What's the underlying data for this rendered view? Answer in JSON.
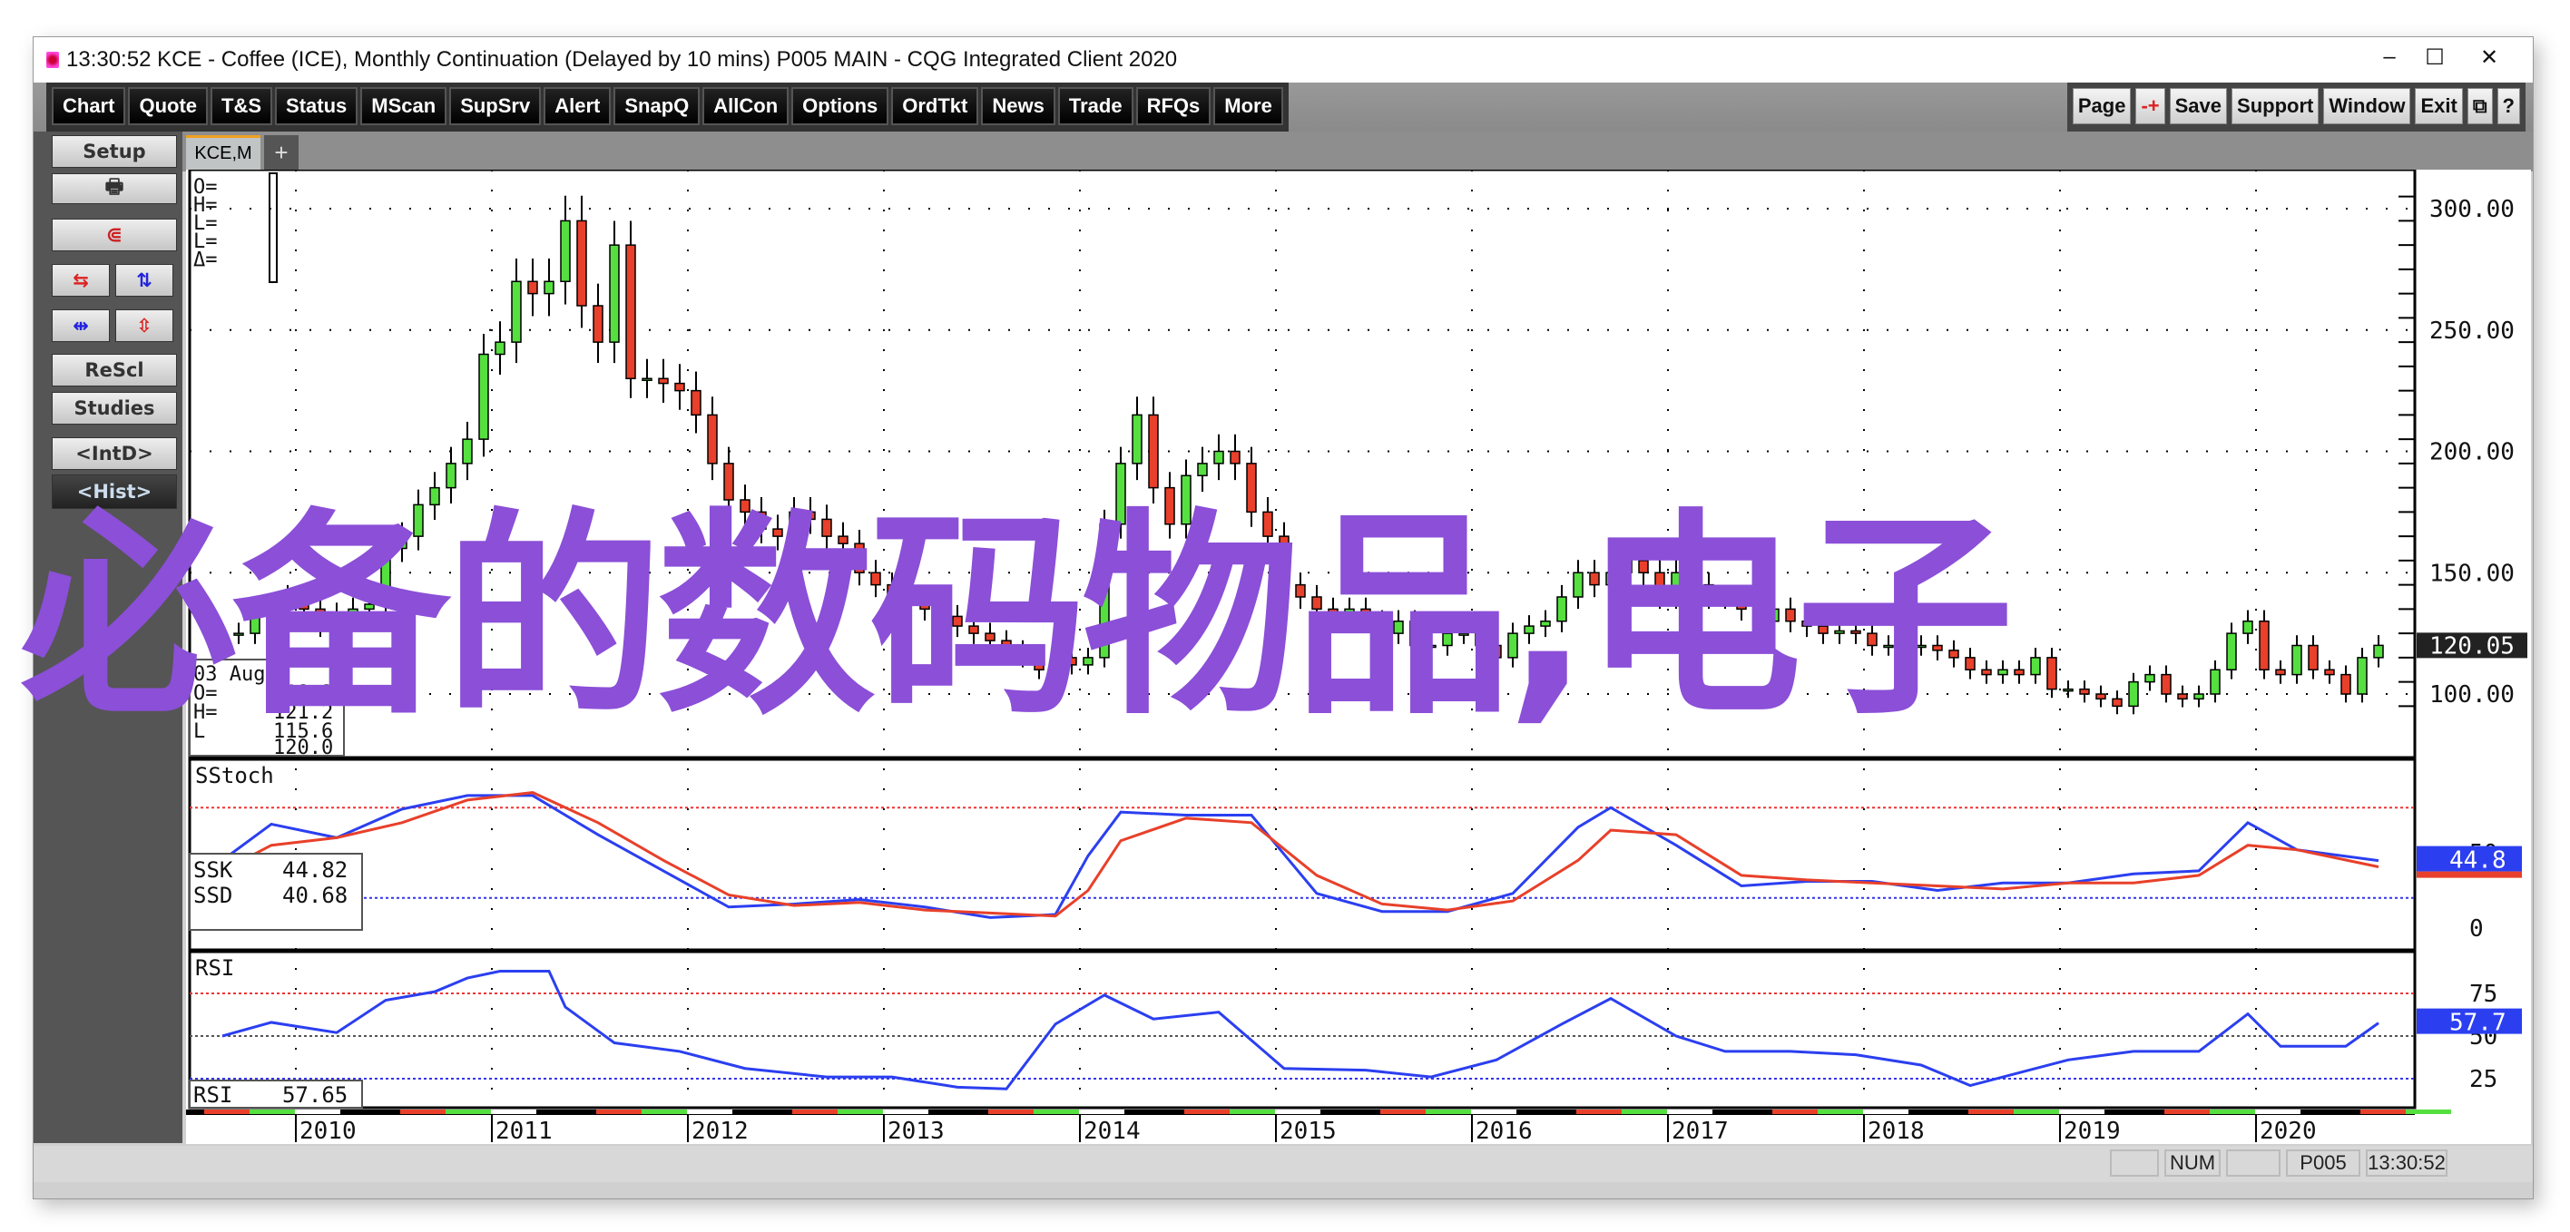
{
  "window": {
    "title": "13:30:52   KCE - Coffee (ICE), Monthly Continuation (Delayed by 10 mins)   P005 MAIN - CQG Integrated Client 2020",
    "minimize": "–",
    "maximize": "☐",
    "close": "✕"
  },
  "toolbar": {
    "left": [
      "Chart",
      "Quote",
      "T&S",
      "Status",
      "MScan",
      "SupSrv",
      "Alert",
      "SnapQ",
      "AllCon",
      "Options",
      "OrdTkt",
      "News",
      "Trade",
      "RFQs",
      "More"
    ],
    "right": [
      "Page",
      "-+",
      "Save",
      "Support",
      "Window",
      "Exit",
      "⧉",
      "?"
    ]
  },
  "tabs": [
    {
      "label": "KCE,M",
      "active": true
    },
    {
      "label": "+"
    }
  ],
  "sidebar": {
    "setup": "Setup",
    "print_icon": "printer-icon",
    "magnet_icon": "magnet-icon",
    "rescl": "ReScl",
    "studies": "Studies",
    "intd": "<IntD>",
    "hist": "<Hist>"
  },
  "cursor_readout": {
    "labels": [
      "O=",
      "H=",
      "L=",
      "L=",
      "Δ="
    ]
  },
  "bar_readout": {
    "date": "03 Aug",
    "o_label": "O=",
    "o": "118.2",
    "h_label": "H=",
    "h": "121.2",
    "l_label": "L",
    "l": "115.6",
    "c": "120.0"
  },
  "watermark": "必备的数码物品,电子",
  "colors": {
    "up": "#55e040",
    "down": "#e8402a",
    "ssk": "#2b3ff0",
    "ssd": "#e8402a",
    "rsi": "#2b3ff0",
    "watermark": "#8b4fd8"
  },
  "chart_data": [
    {
      "type": "candlestick",
      "title": "",
      "start": "2009-08",
      "interval": "month",
      "close": [
        125,
        125,
        133,
        135,
        140,
        135,
        128,
        133,
        135,
        137,
        160,
        165,
        178,
        185,
        195,
        205,
        240,
        245,
        270,
        265,
        270,
        295,
        260,
        245,
        285,
        230,
        230,
        228,
        225,
        215,
        195,
        180,
        175,
        168,
        165,
        175,
        172,
        165,
        162,
        150,
        145,
        140,
        138,
        135,
        132,
        128,
        125,
        122,
        118,
        115,
        110,
        115,
        112,
        115,
        170,
        195,
        215,
        185,
        170,
        190,
        195,
        200,
        195,
        175,
        165,
        145,
        140,
        135,
        132,
        135,
        130,
        125,
        130,
        120,
        120,
        125,
        125,
        120,
        115,
        125,
        128,
        130,
        140,
        150,
        145,
        150,
        155,
        150,
        140,
        150,
        145,
        140,
        140,
        135,
        130,
        135,
        130,
        128,
        125,
        126,
        125,
        120,
        120,
        120,
        120,
        118,
        115,
        110,
        108,
        110,
        108,
        115,
        102,
        102,
        100,
        98,
        95,
        105,
        108,
        100,
        98,
        100,
        110,
        125,
        130,
        110,
        108,
        120,
        110,
        108,
        100,
        115,
        120.05
      ],
      "y_ticks": [
        "300.00",
        "250.00",
        "200.00",
        "150.00",
        "100.00"
      ],
      "y_tick_values": [
        300,
        250,
        200,
        150,
        100
      ],
      "last_price": "120.05",
      "x_ticks": [
        "2010",
        "2011",
        "2012",
        "2013",
        "2014",
        "2015",
        "2016",
        "2017",
        "2018",
        "2019",
        "2020"
      ],
      "grid": true
    },
    {
      "type": "line",
      "title": "SStoch",
      "ylim": [
        0,
        100
      ],
      "levels": [
        80,
        20
      ],
      "y_ticks": [
        "50",
        "0"
      ],
      "y_tick_values": [
        50,
        0
      ],
      "series": [
        {
          "name": "SSK",
          "last": "44.82",
          "axis_badge": "44.8",
          "points": [
            [
              "2009-08",
              45
            ],
            [
              "2009-11",
              69
            ],
            [
              "2010-03",
              60
            ],
            [
              "2010-07",
              79
            ],
            [
              "2010-11",
              88
            ],
            [
              "2011-03",
              88
            ],
            [
              "2011-07",
              62
            ],
            [
              "2011-11",
              38
            ],
            [
              "2012-03",
              14
            ],
            [
              "2012-07",
              16
            ],
            [
              "2012-11",
              19
            ],
            [
              "2013-03",
              14
            ],
            [
              "2013-07",
              7
            ],
            [
              "2013-11",
              9
            ],
            [
              "2014-01",
              48
            ],
            [
              "2014-03",
              77
            ],
            [
              "2014-07",
              75
            ],
            [
              "2014-11",
              75
            ],
            [
              "2015-03",
              23
            ],
            [
              "2015-07",
              11
            ],
            [
              "2015-11",
              11
            ],
            [
              "2016-03",
              23
            ],
            [
              "2016-07",
              67
            ],
            [
              "2016-09",
              80
            ],
            [
              "2017-01",
              55
            ],
            [
              "2017-05",
              28
            ],
            [
              "2017-09",
              31
            ],
            [
              "2018-01",
              31
            ],
            [
              "2018-05",
              25
            ],
            [
              "2018-09",
              30
            ],
            [
              "2019-01",
              30
            ],
            [
              "2019-05",
              36
            ],
            [
              "2019-09",
              38
            ],
            [
              "2019-12",
              70
            ],
            [
              "2020-03",
              52
            ],
            [
              "2020-08",
              44.82
            ]
          ]
        },
        {
          "name": "SSD",
          "last": "40.68",
          "points": [
            [
              "2009-08",
              38
            ],
            [
              "2009-11",
              55
            ],
            [
              "2010-03",
              60
            ],
            [
              "2010-07",
              70
            ],
            [
              "2010-11",
              85
            ],
            [
              "2011-03",
              90
            ],
            [
              "2011-07",
              70
            ],
            [
              "2011-11",
              45
            ],
            [
              "2012-03",
              22
            ],
            [
              "2012-07",
              15
            ],
            [
              "2012-11",
              17
            ],
            [
              "2013-03",
              12
            ],
            [
              "2013-07",
              10
            ],
            [
              "2013-11",
              8
            ],
            [
              "2014-01",
              25
            ],
            [
              "2014-03",
              58
            ],
            [
              "2014-07",
              73
            ],
            [
              "2014-11",
              70
            ],
            [
              "2015-03",
              35
            ],
            [
              "2015-07",
              16
            ],
            [
              "2015-11",
              12
            ],
            [
              "2016-03",
              18
            ],
            [
              "2016-07",
              45
            ],
            [
              "2016-09",
              65
            ],
            [
              "2017-01",
              62
            ],
            [
              "2017-05",
              35
            ],
            [
              "2017-09",
              32
            ],
            [
              "2018-01",
              30
            ],
            [
              "2018-05",
              28
            ],
            [
              "2018-09",
              26
            ],
            [
              "2019-01",
              30
            ],
            [
              "2019-05",
              30
            ],
            [
              "2019-09",
              35
            ],
            [
              "2019-12",
              55
            ],
            [
              "2020-03",
              52
            ],
            [
              "2020-08",
              40.68
            ]
          ]
        }
      ]
    },
    {
      "type": "line",
      "title": "RSI",
      "ylim": [
        0,
        100
      ],
      "levels": [
        75,
        50,
        25
      ],
      "y_ticks": [
        "75",
        "50",
        "25"
      ],
      "y_tick_values": [
        75,
        50,
        25
      ],
      "series": [
        {
          "name": "RSI",
          "last": "57.65",
          "axis_badge": "57.7",
          "points": [
            [
              "2009-08",
              50
            ],
            [
              "2009-11",
              58
            ],
            [
              "2010-03",
              52
            ],
            [
              "2010-06",
              71
            ],
            [
              "2010-09",
              76
            ],
            [
              "2010-11",
              84
            ],
            [
              "2011-01",
              88
            ],
            [
              "2011-04",
              88
            ],
            [
              "2011-05",
              67
            ],
            [
              "2011-08",
              46
            ],
            [
              "2011-12",
              41
            ],
            [
              "2012-04",
              31
            ],
            [
              "2012-09",
              26
            ],
            [
              "2013-01",
              26
            ],
            [
              "2013-05",
              20
            ],
            [
              "2013-08",
              19
            ],
            [
              "2013-11",
              57
            ],
            [
              "2014-02",
              74
            ],
            [
              "2014-05",
              60
            ],
            [
              "2014-09",
              64
            ],
            [
              "2015-01",
              31
            ],
            [
              "2015-06",
              30
            ],
            [
              "2015-10",
              26
            ],
            [
              "2016-02",
              36
            ],
            [
              "2016-06",
              57
            ],
            [
              "2016-09",
              72
            ],
            [
              "2017-01",
              50
            ],
            [
              "2017-04",
              41
            ],
            [
              "2017-08",
              41
            ],
            [
              "2017-12",
              39
            ],
            [
              "2018-04",
              33
            ],
            [
              "2018-07",
              21
            ],
            [
              "2019-01",
              36
            ],
            [
              "2019-05",
              41
            ],
            [
              "2019-09",
              41
            ],
            [
              "2019-12",
              63
            ],
            [
              "2020-02",
              44
            ],
            [
              "2020-06",
              44
            ],
            [
              "2020-08",
              57.65
            ]
          ]
        }
      ]
    }
  ],
  "status": {
    "num": "NUM",
    "page": "P005",
    "time": "13:30:52"
  }
}
